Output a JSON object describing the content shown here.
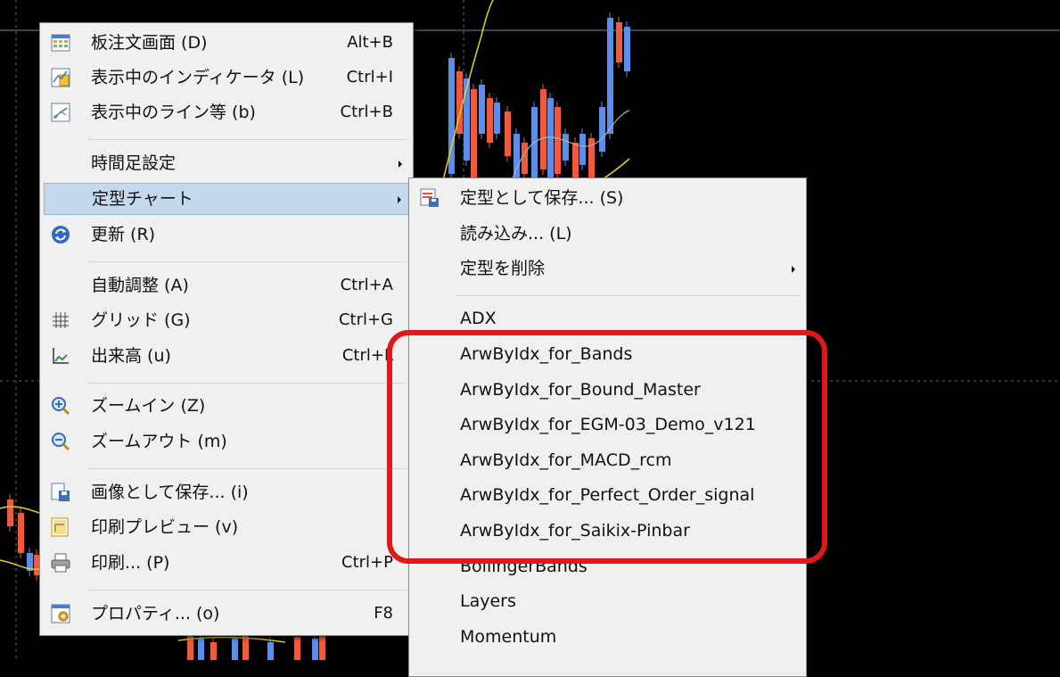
{
  "chart_menu": {
    "items": [
      {
        "label": "板注文画面 (D)",
        "shortcut": "Alt+B",
        "icon": "order-board-icon"
      },
      {
        "label": "表示中のインディケータ (L)",
        "shortcut": "Ctrl+I",
        "icon": "indicators-icon"
      },
      {
        "label": "表示中のライン等 (b)",
        "shortcut": "Ctrl+B",
        "icon": "lines-icon"
      },
      {
        "label": "時間足設定",
        "shortcut": "",
        "icon": ""
      },
      {
        "label": "定型チャート",
        "shortcut": "",
        "icon": ""
      },
      {
        "label": "更新 (R)",
        "shortcut": "",
        "icon": "refresh-icon"
      },
      {
        "label": "自動調整 (A)",
        "shortcut": "Ctrl+A",
        "icon": ""
      },
      {
        "label": "グリッド (G)",
        "shortcut": "Ctrl+G",
        "icon": "grid-icon"
      },
      {
        "label": "出来高 (u)",
        "shortcut": "Ctrl+L",
        "icon": "volume-icon"
      },
      {
        "label": "ズームイン (Z)",
        "shortcut": "",
        "icon": "zoom-in-icon"
      },
      {
        "label": "ズームアウト (m)",
        "shortcut": "",
        "icon": "zoom-out-icon"
      },
      {
        "label": "画像として保存... (i)",
        "shortcut": "",
        "icon": "save-image-icon"
      },
      {
        "label": "印刷プレビュー (v)",
        "shortcut": "",
        "icon": "print-preview-icon"
      },
      {
        "label": "印刷... (P)",
        "shortcut": "Ctrl+P",
        "icon": "print-icon"
      },
      {
        "label": "プロパティ... (o)",
        "shortcut": "F8",
        "icon": "properties-icon"
      }
    ]
  },
  "template_submenu": {
    "items": [
      {
        "label": "定型として保存... (S)",
        "icon": "save-template-icon"
      },
      {
        "label": "読み込み... (L)"
      },
      {
        "label": "定型を削除"
      },
      {
        "label": "ADX"
      },
      {
        "label": "ArwByIdx_for_Bands"
      },
      {
        "label": "ArwByIdx_for_Bound_Master"
      },
      {
        "label": "ArwByIdx_for_EGM-03_Demo_v121"
      },
      {
        "label": "ArwByIdx_for_MACD_rcm"
      },
      {
        "label": "ArwByIdx_for_Perfect_Order_signal"
      },
      {
        "label": "ArwByIdx_for_Saikix-Pinbar"
      },
      {
        "label": "BollingerBands"
      },
      {
        "label": "Layers"
      },
      {
        "label": "Momentum"
      }
    ]
  },
  "colors": {
    "chart_bg": "#000000",
    "bull_candle": "#5b8ee8",
    "bear_candle": "#f05a3c",
    "ma_yellow": "#e3d21f",
    "ma_gray": "#a9b0b8",
    "menu_bg": "#f0f0f0",
    "menu_highlight": "#c4d9ee",
    "annotation_red": "#e01818"
  }
}
